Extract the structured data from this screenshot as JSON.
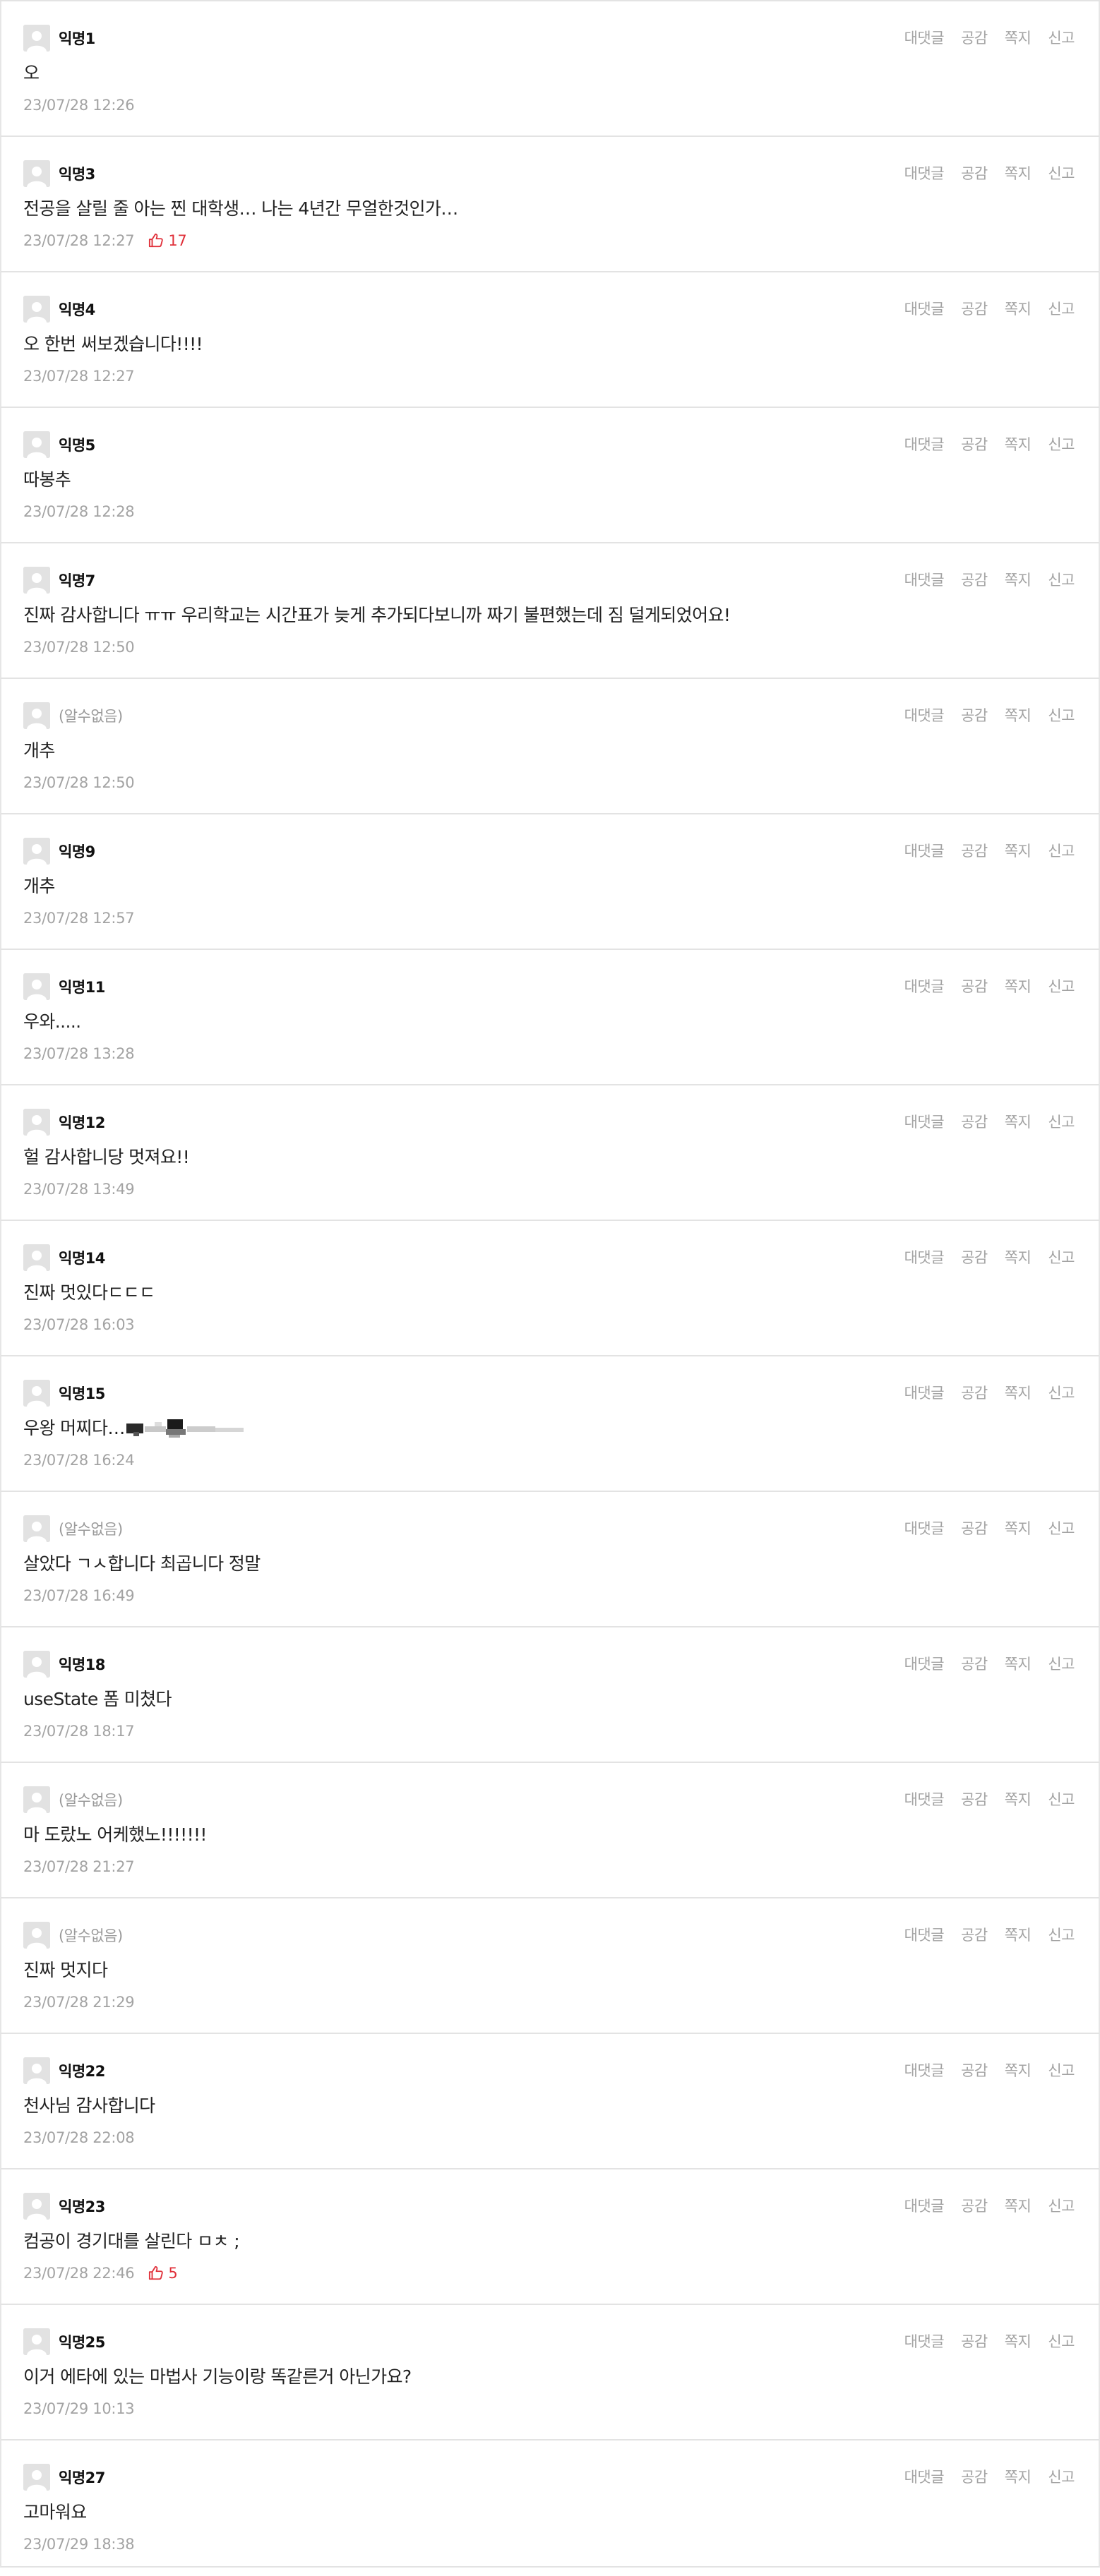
{
  "actions": {
    "reply": "대댓글",
    "like": "공감",
    "message": "쪽지",
    "report": "신고"
  },
  "colors": {
    "like_red": "#e0303a",
    "meta_gray": "#a3a3a3",
    "divider": "#e3e3e3"
  },
  "comments": [
    {
      "nickname": "익명1",
      "unknown": false,
      "text": "오",
      "time": "23/07/28 12:26",
      "likes": ""
    },
    {
      "nickname": "익명3",
      "unknown": false,
      "text": "전공을 살릴 줄 아는 찐 대학생… 나는 4년간 무얼한것인가…",
      "time": "23/07/28 12:27",
      "likes": "17"
    },
    {
      "nickname": "익명4",
      "unknown": false,
      "text": "오 한번 써보겠습니다!!!!",
      "time": "23/07/28 12:27",
      "likes": ""
    },
    {
      "nickname": "익명5",
      "unknown": false,
      "text": "따봉추",
      "time": "23/07/28 12:28",
      "likes": ""
    },
    {
      "nickname": "익명7",
      "unknown": false,
      "text": "진짜 감사합니다 ㅠㅠ 우리학교는 시간표가 늦게 추가되다보니까 짜기 불편했는데 짐 덜게되었어요!",
      "time": "23/07/28 12:50",
      "likes": ""
    },
    {
      "nickname": "(알수없음)",
      "unknown": true,
      "text": "개추",
      "time": "23/07/28 12:50",
      "likes": ""
    },
    {
      "nickname": "익명9",
      "unknown": false,
      "text": "개추",
      "time": "23/07/28 12:57",
      "likes": ""
    },
    {
      "nickname": "익명11",
      "unknown": false,
      "text": "우와.....",
      "time": "23/07/28 13:28",
      "likes": ""
    },
    {
      "nickname": "익명12",
      "unknown": false,
      "text": "헐 감사합니당 멋져요!!",
      "time": "23/07/28 13:49",
      "likes": ""
    },
    {
      "nickname": "익명14",
      "unknown": false,
      "text": "진짜 멋있다ㄷㄷㄷ",
      "time": "23/07/28 16:03",
      "likes": ""
    },
    {
      "nickname": "익명15",
      "unknown": false,
      "text": "우왕 머찌다…",
      "time": "23/07/28 16:24",
      "likes": "",
      "redacted": true
    },
    {
      "nickname": "(알수없음)",
      "unknown": true,
      "text": "살았다 ㄱㅅ합니다 최곱니다 정말",
      "time": "23/07/28 16:49",
      "likes": ""
    },
    {
      "nickname": "익명18",
      "unknown": false,
      "text": "useState 폼 미쳤다",
      "time": "23/07/28 18:17",
      "likes": ""
    },
    {
      "nickname": "(알수없음)",
      "unknown": true,
      "text": "마 도랐노 어케했노!!!!!!!",
      "time": "23/07/28 21:27",
      "likes": ""
    },
    {
      "nickname": "(알수없음)",
      "unknown": true,
      "text": "진짜 멋지다",
      "time": "23/07/28 21:29",
      "likes": ""
    },
    {
      "nickname": "익명22",
      "unknown": false,
      "text": "천사님 감사합니다",
      "time": "23/07/28 22:08",
      "likes": ""
    },
    {
      "nickname": "익명23",
      "unknown": false,
      "text": "컴공이 경기대를 살린다 ㅁㅊ ;",
      "time": "23/07/28 22:46",
      "likes": "5"
    },
    {
      "nickname": "익명25",
      "unknown": false,
      "text": "이거 에타에 있는 마법사 기능이랑 똑같른거 아닌가요?",
      "time": "23/07/29 10:13",
      "likes": ""
    },
    {
      "nickname": "익명27",
      "unknown": false,
      "text": "고마워요",
      "time": "23/07/29 18:38",
      "likes": ""
    }
  ]
}
